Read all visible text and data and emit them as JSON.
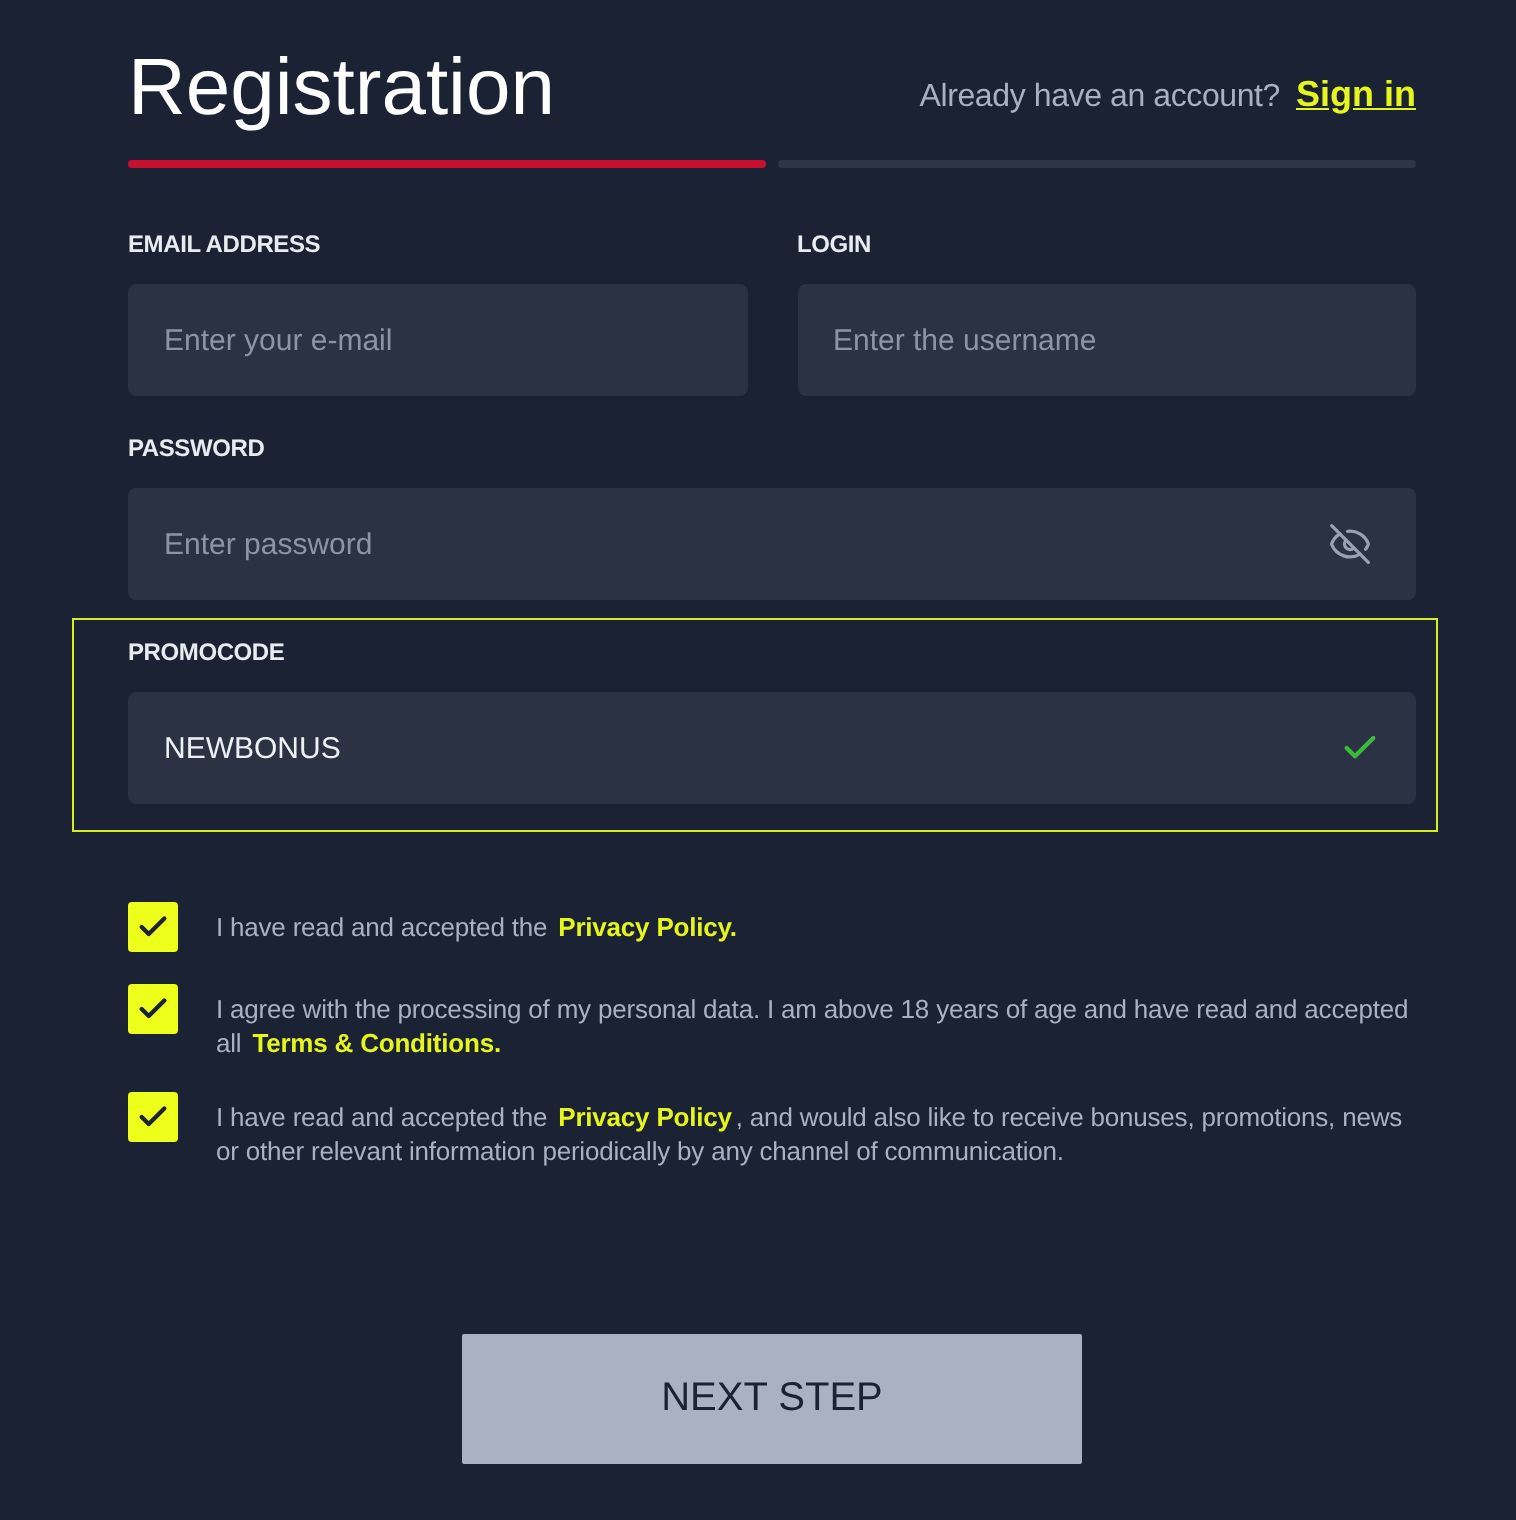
{
  "header": {
    "title": "Registration",
    "prompt": "Already have an account?",
    "link": "Sign in"
  },
  "steps": [
    {
      "active": true
    },
    {
      "active": false
    }
  ],
  "field_rows": [
    {
      "fields": [
        {
          "kind": "text",
          "label": "EMAIL ADDRESS",
          "placeholder": "Enter your e-mail",
          "highlighted": false
        },
        {
          "kind": "text",
          "label": "LOGIN",
          "placeholder": "Enter the username",
          "highlighted": false
        }
      ]
    },
    {
      "fields": [
        {
          "kind": "password",
          "label": "PASSWORD",
          "placeholder": "Enter password",
          "visible": false,
          "highlighted": false
        }
      ]
    },
    {
      "fields": [
        {
          "kind": "code",
          "label": "PROMOCODE",
          "value": "NEWBONUS",
          "valid": true,
          "highlighted": true
        }
      ]
    }
  ],
  "consents": [
    {
      "checked": true,
      "parts": [
        {
          "kind": "text",
          "text": "I have read and accepted the "
        },
        {
          "kind": "link",
          "text": "Privacy Policy."
        }
      ]
    },
    {
      "checked": true,
      "parts": [
        {
          "kind": "text",
          "text": "I agree with the processing of my personal data. I am above 18 years of age and have read and accepted all "
        },
        {
          "kind": "link",
          "text": "Terms & Conditions."
        }
      ]
    },
    {
      "checked": true,
      "parts": [
        {
          "kind": "text",
          "text": "I have read and accepted the "
        },
        {
          "kind": "link",
          "text": "Privacy Policy"
        },
        {
          "kind": "text",
          "text": ", and would also like to receive bonuses, promotions, news or other relevant information periodically by any channel of communication."
        }
      ]
    }
  ],
  "button": {
    "label": "NEXT STEP"
  }
}
